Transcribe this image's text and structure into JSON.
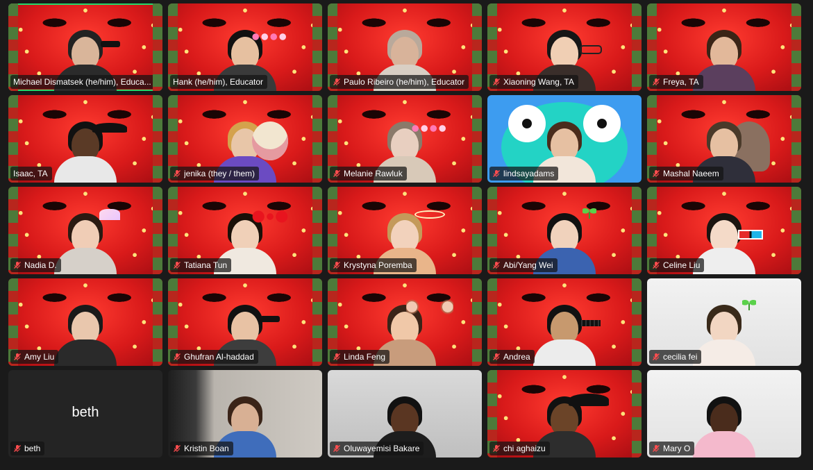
{
  "meeting": {
    "active_speaker_color": "#23d96a",
    "muted_icon": "mic-muted-icon",
    "participants": [
      {
        "name": "Michael Dismatsek (he/him), Educa...",
        "muted": false,
        "bg": "strawberry",
        "accessory": "sunglasses",
        "active": true
      },
      {
        "name": "Hank (he/him), Educator",
        "muted": false,
        "bg": "strawberry",
        "accessory": "flower-crown"
      },
      {
        "name": "Paulo Ribeiro (he/him), Educator",
        "muted": true,
        "bg": "strawberry",
        "accessory": ""
      },
      {
        "name": "Xiaoning Wang, TA",
        "muted": true,
        "bg": "strawberry",
        "accessory": "glasses"
      },
      {
        "name": "Freya, TA",
        "muted": true,
        "bg": "strawberry",
        "accessory": ""
      },
      {
        "name": "Isaac, TA",
        "muted": false,
        "bg": "strawberry",
        "accessory": "cap"
      },
      {
        "name": "jenika (they / them)",
        "muted": true,
        "bg": "strawberry",
        "accessory": "cow-avatar"
      },
      {
        "name": "Melanie Rawluk",
        "muted": true,
        "bg": "strawberry",
        "accessory": "flower-crown"
      },
      {
        "name": "lindsayadams",
        "muted": true,
        "bg": "blue",
        "accessory": "cartoon-eyes"
      },
      {
        "name": "Mashal Naeem",
        "muted": true,
        "bg": "strawberry",
        "accessory": "hijab"
      },
      {
        "name": "Nadia D.",
        "muted": true,
        "bg": "strawberry",
        "accessory": "unicorn"
      },
      {
        "name": "Tatiana Tun",
        "muted": true,
        "bg": "strawberry",
        "accessory": "bow"
      },
      {
        "name": "Krystyna Poremba",
        "muted": true,
        "bg": "strawberry",
        "accessory": "halo"
      },
      {
        "name": "Abi/Yang Wei",
        "muted": true,
        "bg": "strawberry",
        "accessory": "sprout"
      },
      {
        "name": "Celine Liu",
        "muted": true,
        "bg": "strawberry",
        "accessory": "3d-glasses"
      },
      {
        "name": "Amy Liu",
        "muted": true,
        "bg": "strawberry",
        "accessory": ""
      },
      {
        "name": "Ghufran Al-haddad",
        "muted": true,
        "bg": "strawberry",
        "accessory": "sunglasses"
      },
      {
        "name": "Linda Feng",
        "muted": true,
        "bg": "strawberry",
        "accessory": "bear-ears"
      },
      {
        "name": "Andrea",
        "muted": true,
        "bg": "strawberry",
        "accessory": "pixel-sunglasses"
      },
      {
        "name": "cecilia fei",
        "muted": true,
        "bg": "white",
        "accessory": "sprout"
      },
      {
        "name": "beth",
        "muted": true,
        "bg": "dark",
        "accessory": "",
        "video_off": true,
        "center_label": "beth"
      },
      {
        "name": "Kristin Boan",
        "muted": true,
        "bg": "room",
        "accessory": ""
      },
      {
        "name": "Oluwayemisi Bakare",
        "muted": true,
        "bg": "light",
        "accessory": ""
      },
      {
        "name": "chi aghaizu",
        "muted": true,
        "bg": "strawberry",
        "accessory": "pirate"
      },
      {
        "name": "Mary O",
        "muted": true,
        "bg": "white",
        "accessory": ""
      }
    ]
  }
}
